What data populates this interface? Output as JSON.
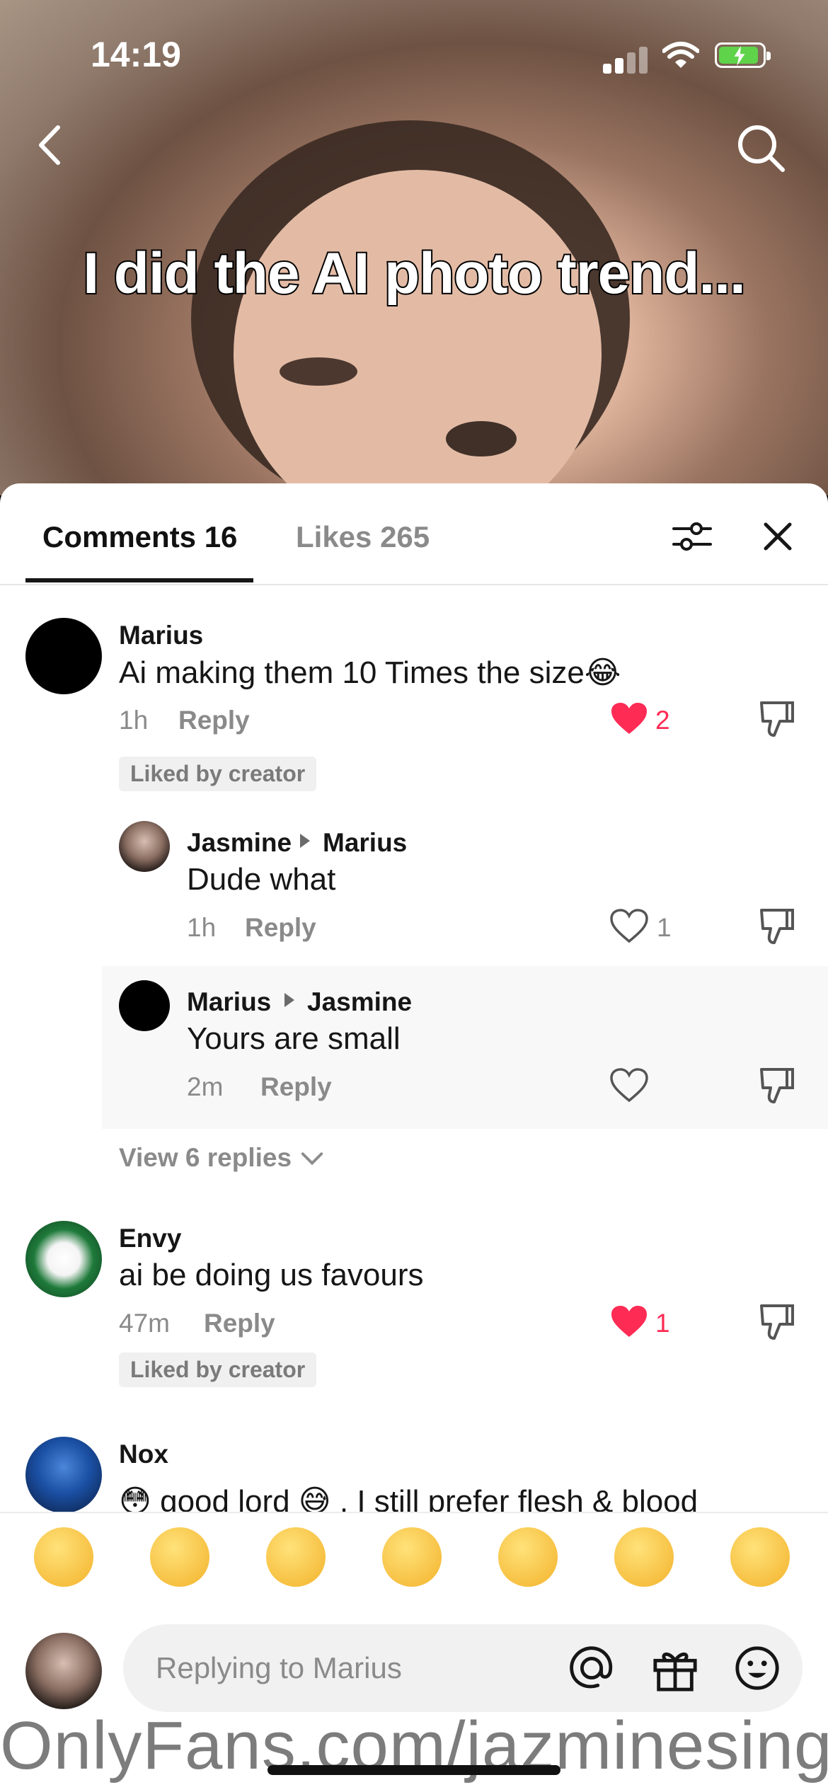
{
  "status_bar": {
    "time": "14:19"
  },
  "video": {
    "caption": "I did the AI photo trend..."
  },
  "tabs": {
    "comments_label": "Comments 16",
    "likes_label": "Likes 265"
  },
  "comments": [
    {
      "user": "Marius",
      "text": "Ai making them 10 Times the size😂",
      "time": "1h",
      "reply_label": "Reply",
      "likes": "2",
      "liked": true,
      "badge": "Liked by creator"
    },
    {
      "user": "Jasmine",
      "reply_to": "Marius",
      "text": "Dude what",
      "time": "1h",
      "reply_label": "Reply",
      "likes": "1",
      "liked": false
    },
    {
      "user": "Marius",
      "reply_to": "Jasmine",
      "text": "Yours are small",
      "time": "2m",
      "reply_label": "Reply",
      "likes": "",
      "liked": false
    },
    {
      "user": "Envy",
      "text": "ai be doing us favours",
      "time": "47m",
      "reply_label": "Reply",
      "likes": "1",
      "liked": true,
      "badge": "Liked by creator"
    },
    {
      "user": "Nox",
      "text": "😳 good lord 😅 , I still prefer flesh & blood"
    }
  ],
  "view_replies": "View 6 replies",
  "emoji_bar": [
    "😁",
    "🥰",
    "😂",
    "😳",
    "😏",
    "😅",
    "🥺"
  ],
  "input": {
    "placeholder": "Replying to Marius"
  },
  "watermark": "OnlyFans.com/jazminesing",
  "colors": {
    "like_red": "#fe2c55",
    "text": "#161616",
    "muted": "#8a8a8a"
  }
}
